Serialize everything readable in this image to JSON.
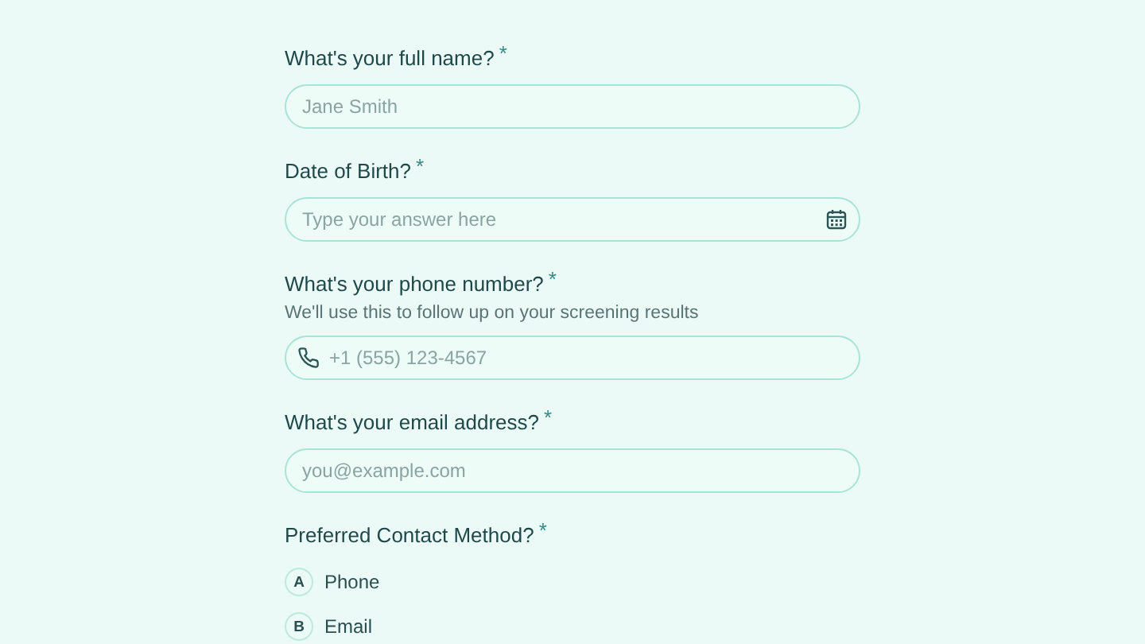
{
  "questions": [
    {
      "kind": "text",
      "label": "What's your full name?",
      "required_mark": "*",
      "placeholder": "Jane Smith"
    },
    {
      "kind": "date",
      "label": "Date of Birth?",
      "required_mark": "*",
      "placeholder": "Type your answer here"
    },
    {
      "kind": "phone",
      "label": "What's your phone number?",
      "required_mark": "*",
      "help": "We'll use this to follow up on your screening results",
      "placeholder": "+1 (555) 123-4567"
    },
    {
      "kind": "text",
      "label": "What's your email address?",
      "required_mark": "*",
      "placeholder": "you@example.com"
    },
    {
      "kind": "choice",
      "label": "Preferred Contact Method?",
      "required_mark": "*",
      "options": [
        {
          "key": "A",
          "label": "Phone",
          "selected": false
        },
        {
          "key": "B",
          "label": "Email",
          "selected": false
        }
      ]
    }
  ]
}
